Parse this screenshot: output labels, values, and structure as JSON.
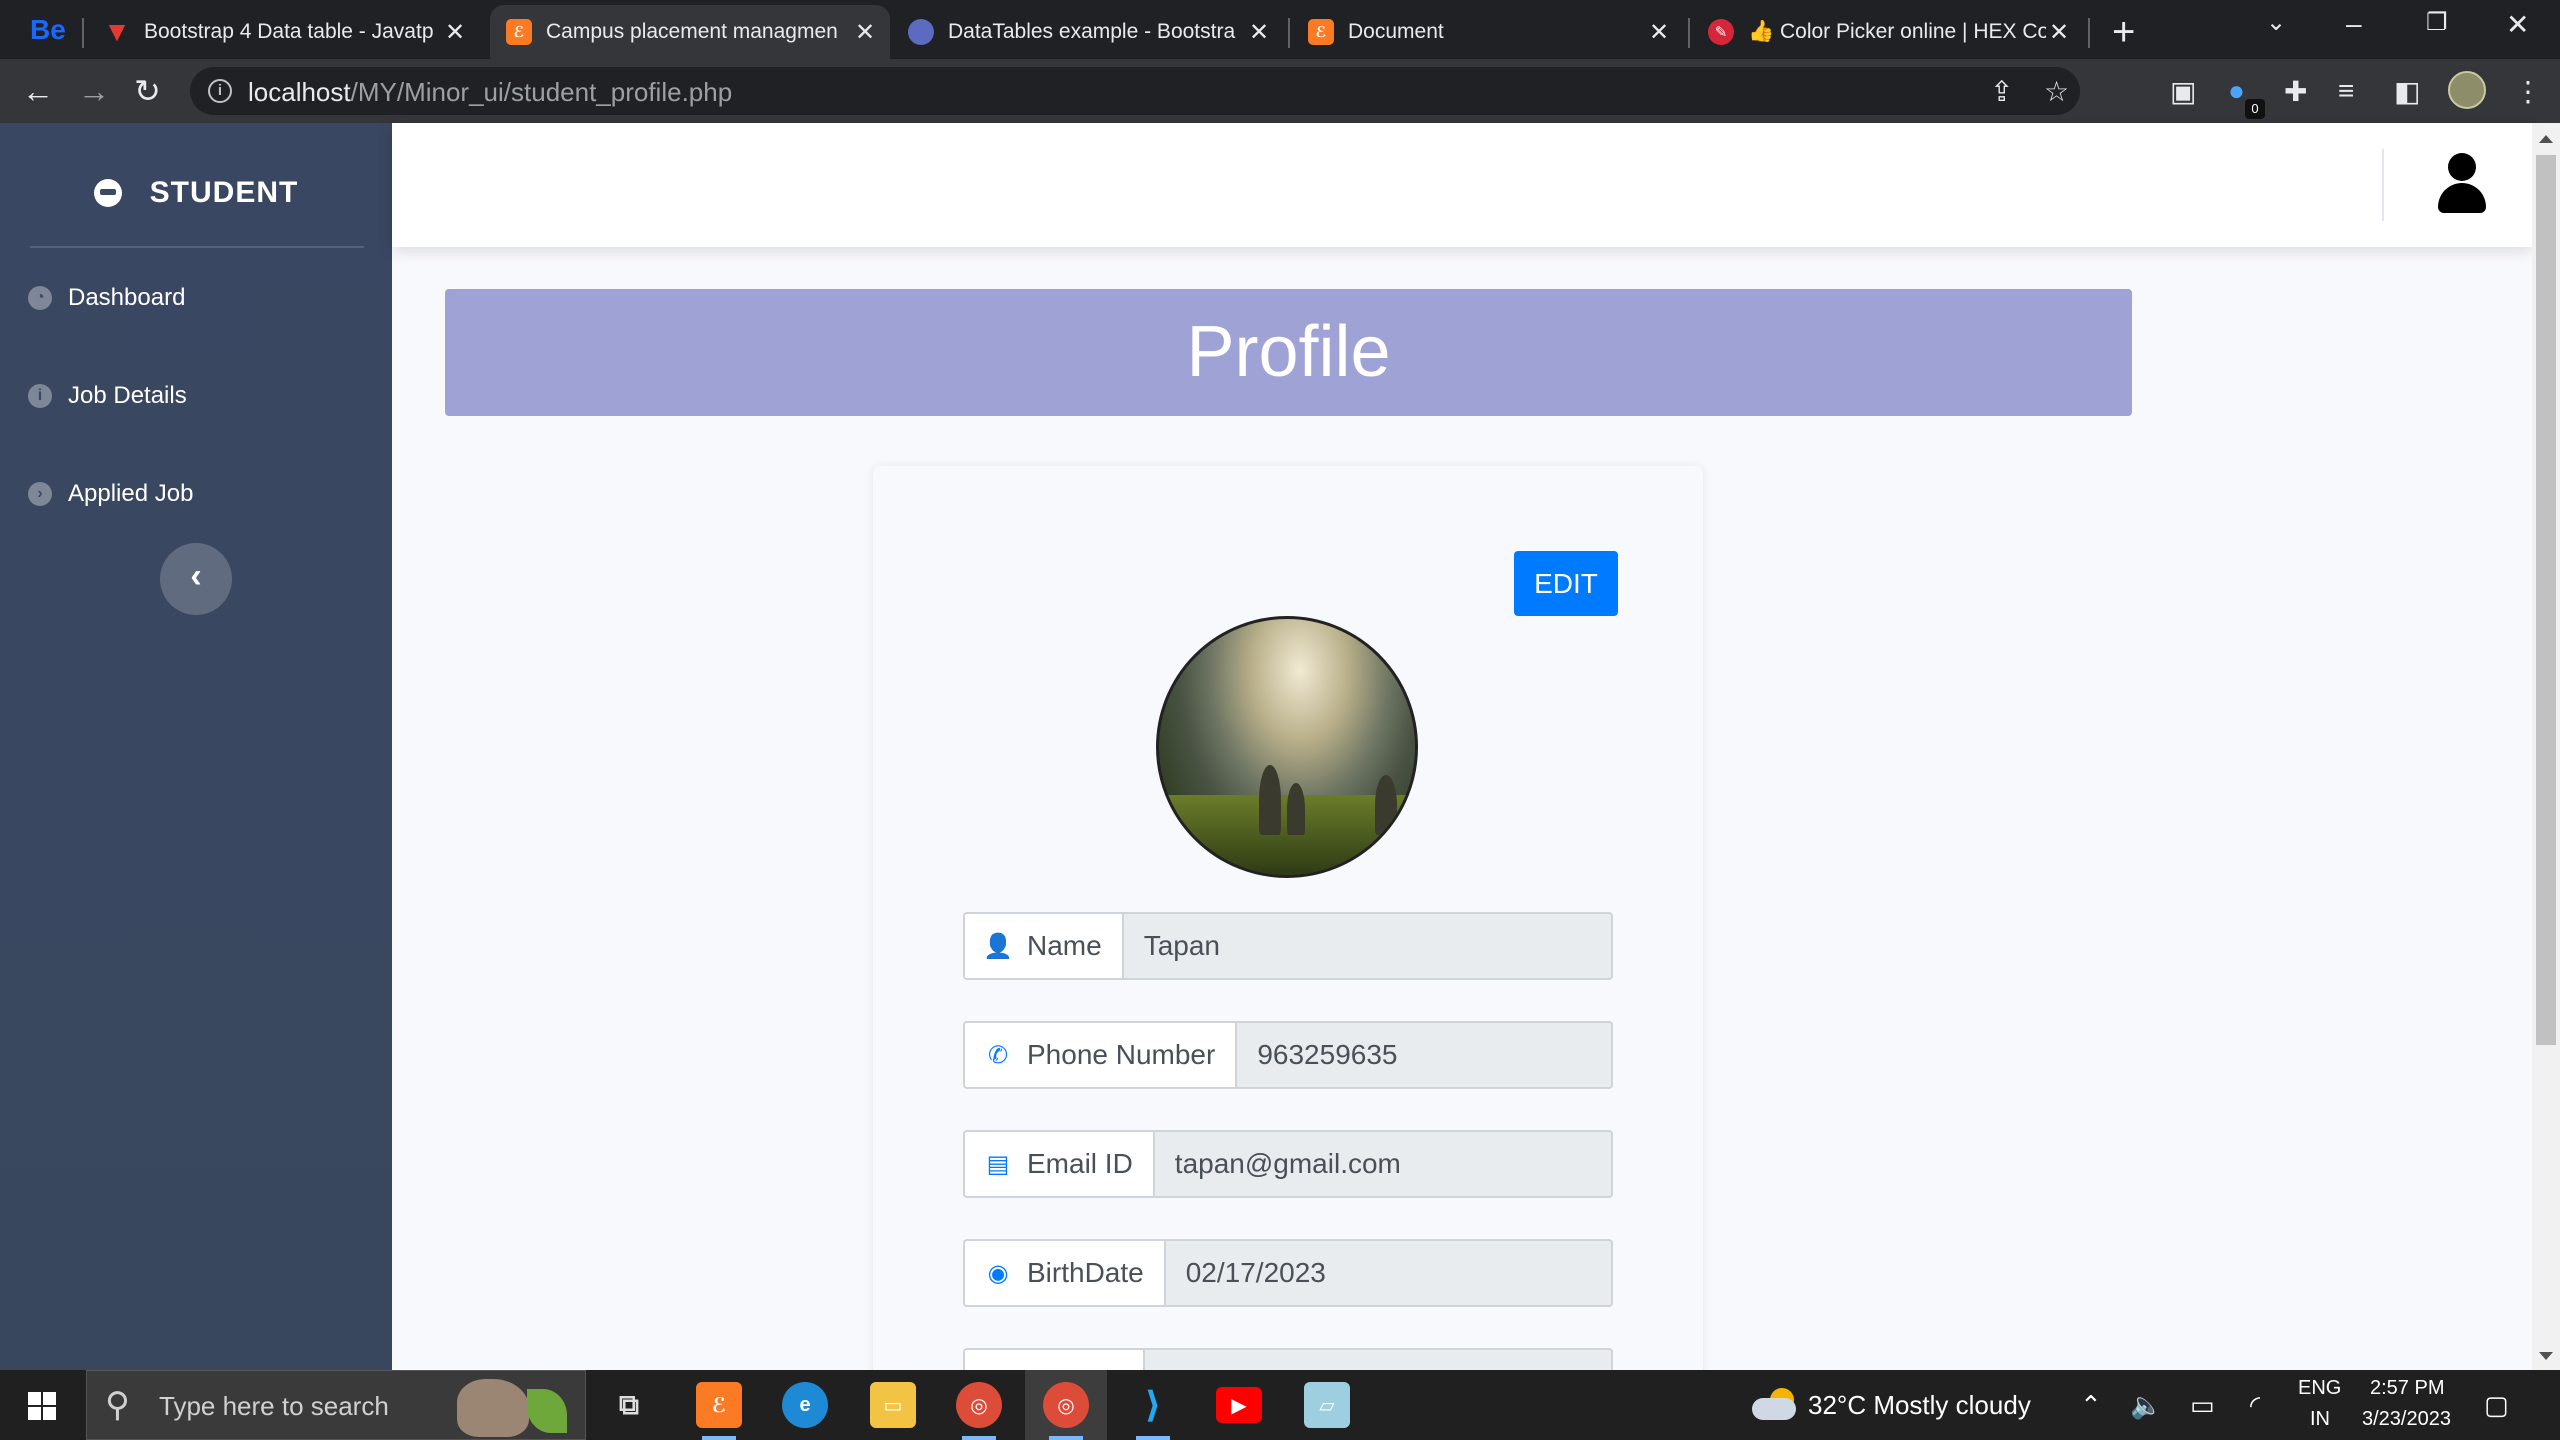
{
  "browser": {
    "tabs": [
      {
        "title": "Bootstrap 4 Data table - Javatp",
        "icon": "vivaldi-v-icon",
        "active": false
      },
      {
        "title": "Campus placement managmen",
        "icon": "xampp-icon",
        "active": true
      },
      {
        "title": "DataTables example - Bootstra",
        "icon": "datatables-icon",
        "active": false
      },
      {
        "title": "Document",
        "icon": "xampp-icon",
        "active": false
      },
      {
        "title": "👍 Color Picker online | HEX Co",
        "icon": "color-picker-icon",
        "active": false
      }
    ],
    "pinned_tab_label": "Be",
    "url_host": "localhost",
    "url_path": "/MY/Minor_ui/student_profile.php",
    "extension_badge": "0"
  },
  "sidebar": {
    "brand": "STUDENT",
    "items": [
      {
        "label": "Dashboard",
        "icon": "dashboard-icon"
      },
      {
        "label": "Job Details",
        "icon": "info-icon"
      },
      {
        "label": "Applied Job",
        "icon": "arrow-circle-icon"
      }
    ],
    "collapse_glyph": "‹"
  },
  "page": {
    "title": "Profile",
    "edit_label": "EDIT"
  },
  "profile": {
    "fields": [
      {
        "label": "Name",
        "value": "Tapan",
        "icon": "user-icon"
      },
      {
        "label": "Phone Number",
        "value": "963259635",
        "icon": "phone-icon"
      },
      {
        "label": "Email ID",
        "value": "tapan@gmail.com",
        "icon": "id-card-icon"
      },
      {
        "label": "BirthDate",
        "value": "02/17/2023",
        "icon": "dot-circle-icon"
      }
    ]
  },
  "taskbar": {
    "search_placeholder": "Type here to search",
    "weather": "32°C  Mostly cloudy",
    "lang_top": "ENG",
    "lang_bottom": "IN",
    "time": "2:57 PM",
    "date": "3/23/2023"
  },
  "colors": {
    "sidebar": "#3b4a63",
    "banner": "#9fa2d4",
    "primary": "#007bff"
  }
}
